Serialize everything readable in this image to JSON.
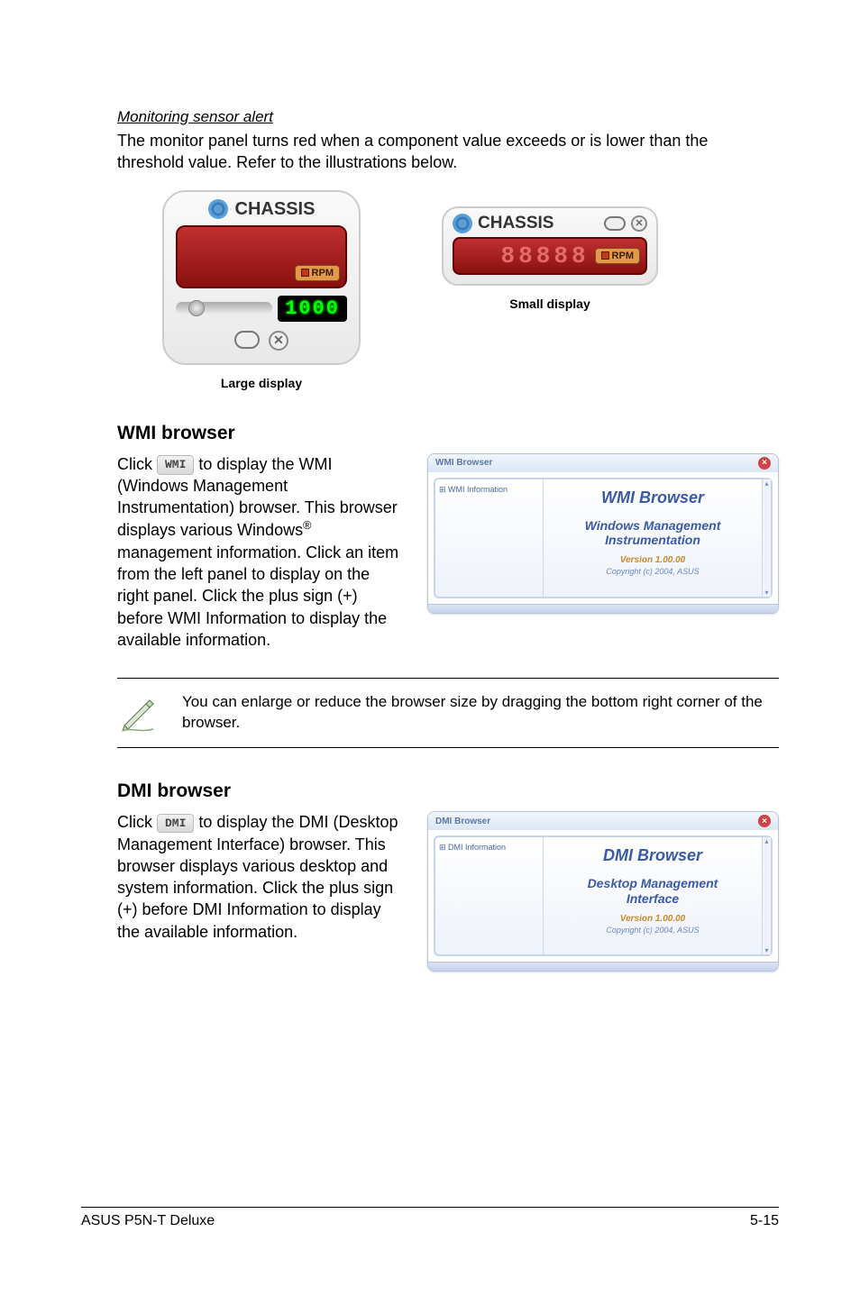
{
  "monitoring": {
    "heading": "Monitoring sensor alert",
    "body": "The monitor panel turns red when a component value exceeds or is lower than the threshold value. Refer to the illustrations below.",
    "label_chassis": "CHASSIS",
    "rpm_label": "RPM",
    "lcd_value": "1000",
    "seg_value": "88888",
    "large_caption": "Large display",
    "small_caption": "Small display"
  },
  "wmi": {
    "heading": "WMI browser",
    "chip": "WMI",
    "text_before_chip": "Click ",
    "text_after_chip": " to display the WMI (Windows Management Instrumentation) browser. This browser displays various Windows",
    "text_tail": " management information. Click an item from the left panel to display on the right panel. Click the plus sign (+) before WMI Information to display the available information.",
    "window_title": "WMI Browser",
    "tree_label": "WMI Information",
    "panel_title": "WMI Browser",
    "panel_sub1": "Windows Management",
    "panel_sub2": "Instrumentation",
    "version": "Version 1.00.00",
    "copyright": "Copyright (c) 2004, ASUS"
  },
  "note": {
    "text": "You can enlarge or reduce the browser size by dragging the bottom right corner of the browser."
  },
  "dmi": {
    "heading": "DMI browser",
    "chip": "DMI",
    "text_before_chip": "Click ",
    "text_after_chip": " to display the DMI (Desktop Management Interface) browser. This browser displays various desktop and system information. Click the plus sign (+) before DMI Information to display the available information.",
    "window_title": "DMI Browser",
    "tree_label": "DMI Information",
    "panel_title": "DMI Browser",
    "panel_sub1": "Desktop Management",
    "panel_sub2": "Interface",
    "version": "Version 1.00.00",
    "copyright": "Copyright (c) 2004, ASUS"
  },
  "footer": {
    "left": "ASUS P5N-T Deluxe",
    "right": "5-15"
  }
}
